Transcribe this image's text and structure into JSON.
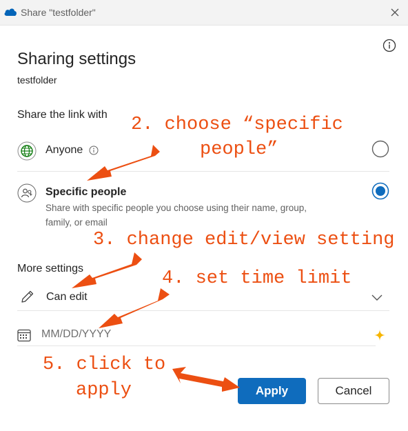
{
  "window": {
    "title": "Share \"testfolder\"",
    "app_icon": "onedrive-cloud-icon",
    "close_icon": "close-icon"
  },
  "panel": {
    "heading": "Sharing settings",
    "item_name": "testfolder",
    "info_icon": "info-icon"
  },
  "share_with": {
    "label": "Share the link with",
    "options": [
      {
        "label": "Anyone",
        "icon": "globe-icon",
        "selected": false,
        "has_info": true
      },
      {
        "label": "Specific people",
        "icon": "people-icon",
        "selected": true,
        "description": "Share with specific people you choose using their name, group, family, or email"
      }
    ]
  },
  "more_settings": {
    "label": "More settings",
    "permission": {
      "value": "Can edit",
      "icon": "pencil-icon"
    },
    "expiration": {
      "placeholder": "MM/DD/YYYY",
      "icon": "calendar-icon"
    }
  },
  "buttons": {
    "apply": "Apply",
    "cancel": "Cancel"
  },
  "annotations": {
    "step2_line1": "2. choose “specific",
    "step2_line2": "people”",
    "step3": "3. change edit/view setting",
    "step4": "4. set time limit",
    "step5_line1": "5. click to",
    "step5_line2": "apply"
  },
  "colors": {
    "accent": "#0f6cbd",
    "annotation": "#ec4f12",
    "globe": "#107c10",
    "sparkle": "#f7b500"
  }
}
